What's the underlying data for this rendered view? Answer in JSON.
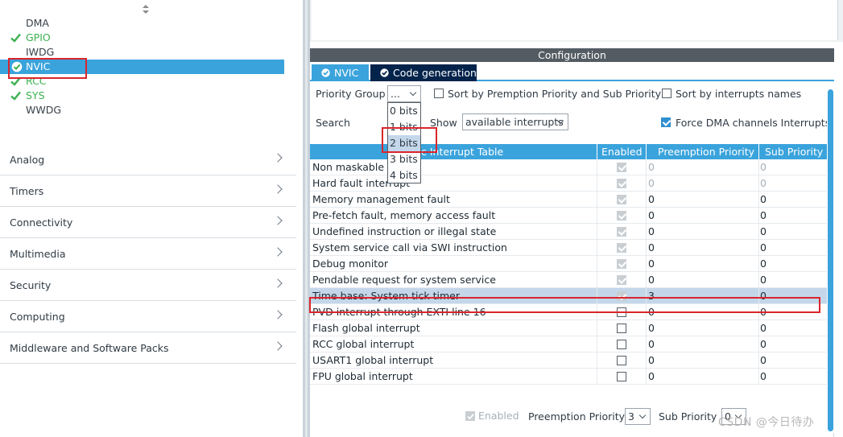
{
  "left_panel": {
    "peripherals": [
      {
        "label": "DMA",
        "status": "none"
      },
      {
        "label": "GPIO",
        "status": "ok"
      },
      {
        "label": "IWDG",
        "status": "none"
      },
      {
        "label": "NVIC",
        "status": "selected"
      },
      {
        "label": "RCC",
        "status": "ok"
      },
      {
        "label": "SYS",
        "status": "ok"
      },
      {
        "label": "WWDG",
        "status": "none"
      }
    ],
    "categories": [
      "Analog",
      "Timers",
      "Connectivity",
      "Multimedia",
      "Security",
      "Computing",
      "Middleware and Software Packs"
    ]
  },
  "config": {
    "title": "Configuration",
    "tabs": [
      {
        "label": "NVIC",
        "active": false
      },
      {
        "label": "Code generation",
        "active": true
      }
    ],
    "priority_group_label": "Priority Group",
    "priority_group_value": "...",
    "priority_group_options": [
      "0 bits f",
      "1 bits f",
      "2 bits f",
      "3 bits f",
      "4 bits f"
    ],
    "priority_group_hovered": "2 bits f",
    "sort_premption_label": "Sort by Premption Priority and Sub Priority",
    "sort_names_label": "Sort by interrupts names",
    "search_label": "Search",
    "show_label": "Show",
    "show_value": "available interrupts",
    "force_dma_label": "Force DMA channels Interrupts",
    "force_dma_checked": true
  },
  "table": {
    "headers": [
      "c Interrupt Table",
      "Enabled",
      "Preemption Priority",
      "Sub Priority"
    ],
    "rows": [
      {
        "name": "Non maskable in",
        "enabled": true,
        "locked": true,
        "preemption": "0",
        "sub": "0",
        "muted": true
      },
      {
        "name": "Hard fault interrupt",
        "enabled": true,
        "locked": true,
        "preemption": "0",
        "sub": "0",
        "muted": true
      },
      {
        "name": "Memory management fault",
        "enabled": true,
        "locked": true,
        "preemption": "0",
        "sub": "0",
        "muted": false
      },
      {
        "name": "Pre-fetch fault, memory access fault",
        "enabled": true,
        "locked": true,
        "preemption": "0",
        "sub": "0",
        "muted": false
      },
      {
        "name": "Undefined instruction or illegal state",
        "enabled": true,
        "locked": true,
        "preemption": "0",
        "sub": "0",
        "muted": false
      },
      {
        "name": "System service call via SWI instruction",
        "enabled": true,
        "locked": true,
        "preemption": "0",
        "sub": "0",
        "muted": false
      },
      {
        "name": "Debug monitor",
        "enabled": true,
        "locked": true,
        "preemption": "0",
        "sub": "0",
        "muted": false
      },
      {
        "name": "Pendable request for system service",
        "enabled": true,
        "locked": true,
        "preemption": "0",
        "sub": "0",
        "muted": false
      },
      {
        "name": "Time base: System tick timer",
        "enabled": true,
        "locked": true,
        "preemption": "3",
        "sub": "0",
        "muted": false,
        "highlight": true
      },
      {
        "name": "PVD interrupt through EXTI line 16",
        "enabled": false,
        "locked": false,
        "preemption": "0",
        "sub": "0",
        "muted": false
      },
      {
        "name": "Flash global interrupt",
        "enabled": false,
        "locked": false,
        "preemption": "0",
        "sub": "0",
        "muted": false
      },
      {
        "name": "RCC global interrupt",
        "enabled": false,
        "locked": false,
        "preemption": "0",
        "sub": "0",
        "muted": false
      },
      {
        "name": "USART1 global interrupt",
        "enabled": false,
        "locked": false,
        "preemption": "0",
        "sub": "0",
        "muted": false
      },
      {
        "name": "FPU global interrupt",
        "enabled": false,
        "locked": false,
        "preemption": "0",
        "sub": "0",
        "muted": false
      }
    ]
  },
  "bottom": {
    "enabled_label": "Enabled",
    "preemption_label": "Preemption Priority",
    "preemption_value": "3",
    "sub_label": "Sub Priority",
    "sub_value": "0"
  },
  "watermark": "CSDN @今日待办",
  "colors": {
    "accent": "#3aa3dc",
    "dark_tab": "#03234b",
    "ok_green": "#3bb04f",
    "annotation_red": "#d9262c",
    "config_bar": "#545c63"
  }
}
